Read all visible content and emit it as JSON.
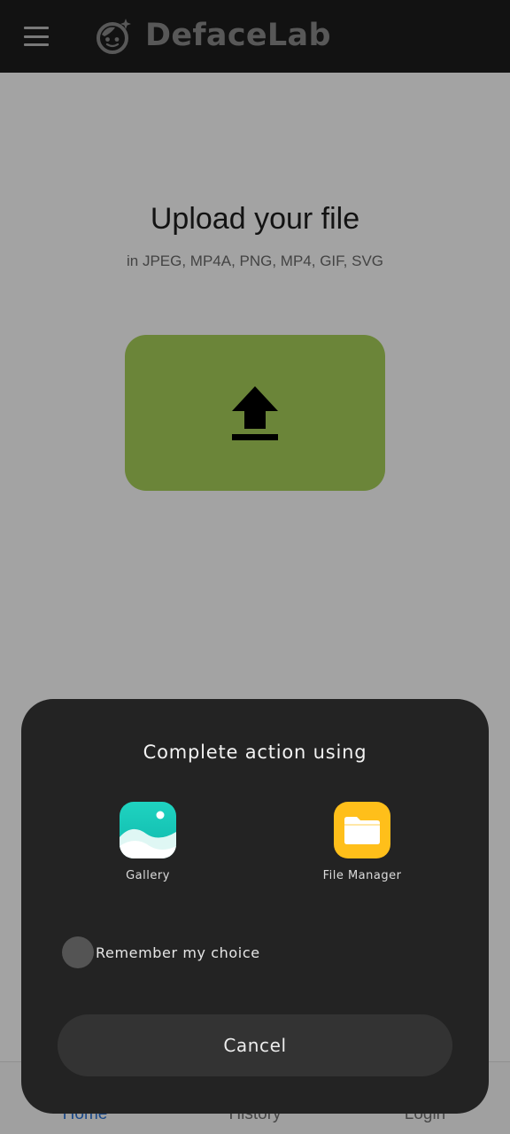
{
  "app": {
    "title": "DefaceLab"
  },
  "main": {
    "upload_title": "Upload your file",
    "upload_subtitle": "in JPEG, MP4A, PNG, MP4, GIF, SVG",
    "upload_icon": "upload-icon",
    "accent_color": "#a8d15a"
  },
  "bottom_nav": {
    "items": [
      {
        "label": "Home",
        "active": true
      },
      {
        "label": "History",
        "active": false
      },
      {
        "label": "Login",
        "active": false
      }
    ],
    "active_color": "#2a72d5"
  },
  "dialog": {
    "title": "Complete action using",
    "options": [
      {
        "label": "Gallery",
        "icon": "gallery-icon"
      },
      {
        "label": "File Manager",
        "icon": "folder-icon"
      }
    ],
    "remember_label": "Remember my choice",
    "cancel_label": "Cancel"
  }
}
